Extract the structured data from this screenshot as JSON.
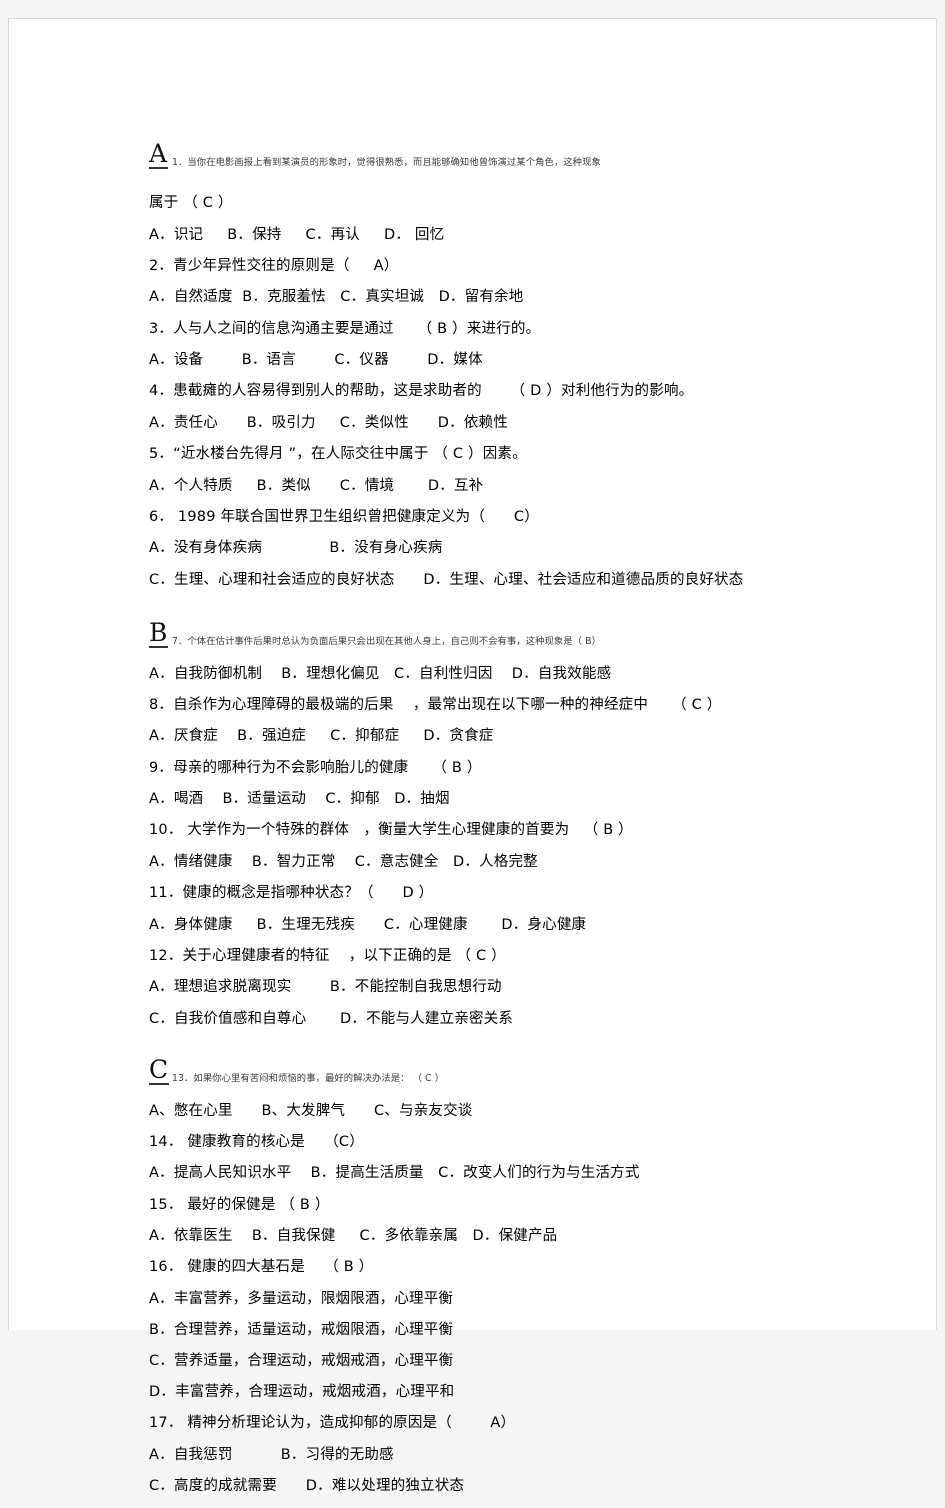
{
  "document": {
    "title": "心理健康选择题试卷",
    "sections": [
      {
        "marker": "A",
        "lead_line": "1．当你在电影画报上看到某演员的形象时，觉得很熟悉，而且能够确知他曾饰演过某个角色，这种现象",
        "lines": [
          "属于 （ C ）",
          "A．识记     B．保持     C．再认     D． 回忆",
          "2．青少年异性交往的原则是（     A）",
          "A．自然适度  B．克服羞怯   C．真实坦诚   D．留有余地",
          "3．人与人之间的信息沟通主要是通过     （ B ）来进行的。",
          "A．设备        B．语言        C．仪器        D．媒体",
          "4．患截瘫的人容易得到别人的帮助，这是求助者的      （ D ）对利他行为的影响。",
          "A．责任心      B．吸引力     C．类似性      D．依赖性",
          "5．“近水楼台先得月 ”，在人际交往中属于 （ C ）因素。",
          "A．个人特质     B．类似      C．情境       D．互补",
          "6． 1989 年联合国世界卫生组织曾把健康定义为（      C）",
          "A．没有身体疾病              B．没有身心疾病",
          "C．生理、心理和社会适应的良好状态      D．生理、心理、社会适应和道德品质的良好状态"
        ]
      },
      {
        "marker": "B",
        "lead_line": "7．个体在估计事件后果时总认为负面后果只会出现在其他人身上，自己则不会有事，这种现象是（                B）",
        "lines": [
          "A．自我防御机制    B．理想化偏见   C．自利性归因    D．自我效能感",
          "8．自杀作为心理障碍的最极端的后果    ，最常出现在以下哪一种的神经症中     （ C ）",
          "A．厌食症    B．强迫症     C．抑郁症     D．贪食症",
          "9．母亲的哪种行为不会影响胎儿的健康     （ B ）",
          "A．喝酒    B．适量运动    C．抑郁   D．抽烟",
          "10． 大学作为一个特殊的群体   ，衡量大学生心理健康的首要为   （ B ）",
          "A．情绪健康    B．智力正常    C．意志健全   D．人格完整",
          "11．健康的概念是指哪种状态？（      D ）",
          "A．身体健康     B．生理无残疾      C．心理健康       D．身心健康",
          "12．关于心理健康者的特征    ，以下正确的是 （ C ）",
          "A．理想追求脱离现实        B．不能控制自我思想行动",
          "C．自我价值感和自尊心       D．不能与人建立亲密关系"
        ]
      },
      {
        "marker": "C",
        "lead_line": "13．如果你心里有苦闷和烦恼的事，最好的解决办法是：          （ C ）",
        "lines": [
          "A、憋在心里      B、大发脾气      C、与亲友交谈",
          "14． 健康教育的核心是    （C）",
          "A．提高人民知识水平    B．提高生活质量   C．改变人们的行为与生活方式",
          "15． 最好的保健是 （ B ）",
          "A．依靠医生    B．自我保健     C．多依靠亲属   D．保健产品",
          "16． 健康的四大基石是    （ B ）",
          "A．丰富营养，多量运动，限烟限酒，心理平衡",
          "B．合理营养，适量运动，戒烟限酒，心理平衡",
          "C．营养适量，合理运动，戒烟戒酒，心理平衡",
          "D．丰富营养，合理运动，戒烟戒酒，心理平和",
          "17． 精神分析理论认为，造成抑郁的原因是（        A）",
          "A．自我惩罚          B．习得的无助感",
          "C．高度的成就需要      D．难以处理的独立状态"
        ]
      }
    ]
  }
}
